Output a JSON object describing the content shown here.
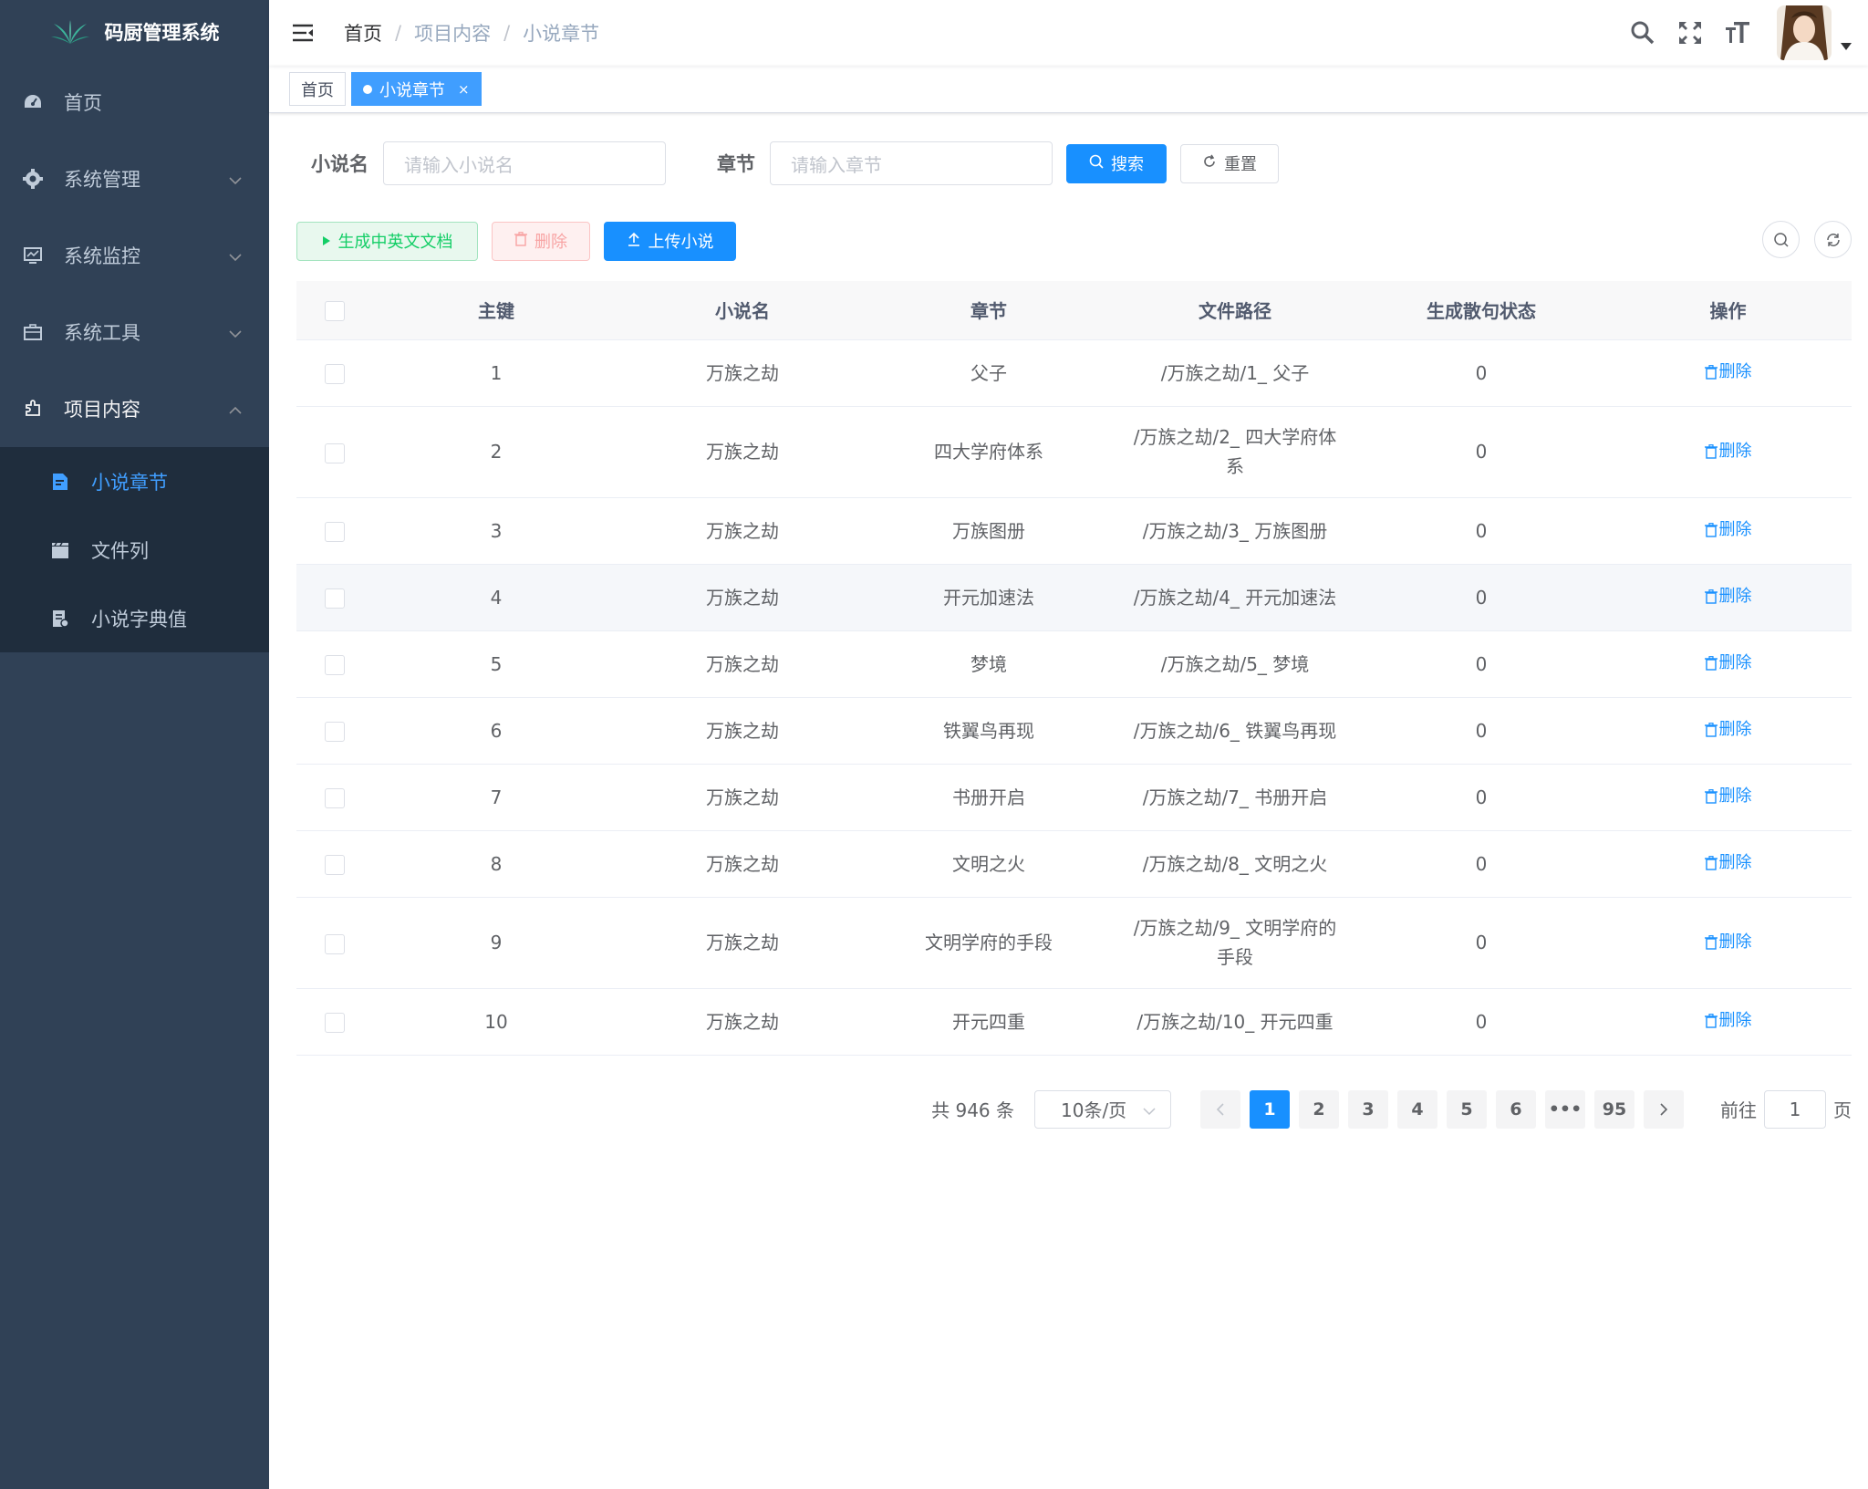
{
  "app": {
    "title": "码厨管理系统"
  },
  "sidebar": {
    "items": [
      {
        "label": "首页",
        "icon": "dashboard-icon"
      },
      {
        "label": "系统管理",
        "icon": "gear-icon"
      },
      {
        "label": "系统监控",
        "icon": "monitor-icon"
      },
      {
        "label": "系统工具",
        "icon": "toolbox-icon"
      },
      {
        "label": "项目内容",
        "icon": "puzzle-icon"
      }
    ],
    "submenu": [
      {
        "label": "小说章节",
        "icon": "document-icon"
      },
      {
        "label": "文件列",
        "icon": "clapper-icon"
      },
      {
        "label": "小说字典值",
        "icon": "dictionary-icon"
      }
    ]
  },
  "breadcrumb": [
    "首页",
    "项目内容",
    "小说章节"
  ],
  "tags": [
    {
      "label": "首页"
    },
    {
      "label": "小说章节",
      "close": "×"
    }
  ],
  "search": {
    "novel_label": "小说名",
    "novel_placeholder": "请输入小说名",
    "chapter_label": "章节",
    "chapter_placeholder": "请输入章节",
    "search_btn": "搜索",
    "reset_btn": "重置"
  },
  "toolbar": {
    "generate_btn": "生成中英文文档",
    "delete_btn": "删除",
    "upload_btn": "上传小说"
  },
  "table": {
    "headers": [
      "主键",
      "小说名",
      "章节",
      "文件路径",
      "生成散句状态",
      "操作"
    ],
    "op_label": "删除",
    "rows": [
      {
        "id": "1",
        "novel": "万族之劫",
        "chapter": "父子",
        "path": "/万族之劫/1_ 父子",
        "status": "0"
      },
      {
        "id": "2",
        "novel": "万族之劫",
        "chapter": "四大学府体系",
        "path": "/万族之劫/2_ 四大学府体系",
        "status": "0"
      },
      {
        "id": "3",
        "novel": "万族之劫",
        "chapter": "万族图册",
        "path": "/万族之劫/3_ 万族图册",
        "status": "0"
      },
      {
        "id": "4",
        "novel": "万族之劫",
        "chapter": "开元加速法",
        "path": "/万族之劫/4_ 开元加速法",
        "status": "0"
      },
      {
        "id": "5",
        "novel": "万族之劫",
        "chapter": "梦境",
        "path": "/万族之劫/5_ 梦境",
        "status": "0"
      },
      {
        "id": "6",
        "novel": "万族之劫",
        "chapter": "铁翼鸟再现",
        "path": "/万族之劫/6_ 铁翼鸟再现",
        "status": "0"
      },
      {
        "id": "7",
        "novel": "万族之劫",
        "chapter": "书册开启",
        "path": "/万族之劫/7_ 书册开启",
        "status": "0"
      },
      {
        "id": "8",
        "novel": "万族之劫",
        "chapter": "文明之火",
        "path": "/万族之劫/8_ 文明之火",
        "status": "0"
      },
      {
        "id": "9",
        "novel": "万族之劫",
        "chapter": "文明学府的手段",
        "path": "/万族之劫/9_ 文明学府的手段",
        "status": "0"
      },
      {
        "id": "10",
        "novel": "万族之劫",
        "chapter": "开元四重",
        "path": "/万族之劫/10_ 开元四重",
        "status": "0"
      }
    ]
  },
  "pagination": {
    "total": "共 946 条",
    "page_size": "10条/页",
    "pages": [
      "1",
      "2",
      "3",
      "4",
      "5",
      "6",
      "•••",
      "95"
    ],
    "current": "1",
    "jumper_prefix": "前往",
    "jumper_value": "1",
    "jumper_suffix": "页"
  },
  "colors": {
    "sidebar_bg": "#304156",
    "submenu_bg": "#1f2d3d",
    "primary": "#1890ff",
    "success": "#13ce66",
    "danger": "#f56c6c"
  }
}
